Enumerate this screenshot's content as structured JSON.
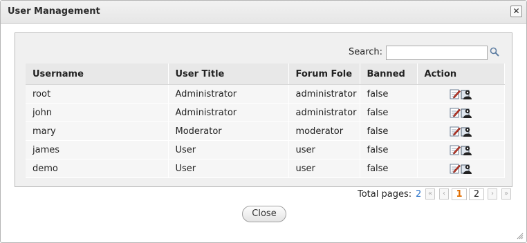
{
  "dialog": {
    "title": "User Management"
  },
  "search": {
    "label": "Search:",
    "value": "",
    "placeholder": ""
  },
  "table": {
    "columns": [
      "Username",
      "User Title",
      "Forum Fole",
      "Banned",
      "Action"
    ],
    "rows": [
      {
        "username": "root",
        "title": "Administrator",
        "role": "administrator",
        "banned": "false"
      },
      {
        "username": "john",
        "title": "Administrator",
        "role": "administrator",
        "banned": "false"
      },
      {
        "username": "mary",
        "title": "Moderator",
        "role": "moderator",
        "banned": "false"
      },
      {
        "username": "james",
        "title": "User",
        "role": "user",
        "banned": "false"
      },
      {
        "username": "demo",
        "title": "User",
        "role": "user",
        "banned": "false"
      }
    ],
    "action_icons": [
      "edit-icon",
      "permissions-icon"
    ]
  },
  "pager": {
    "label": "Total pages:",
    "total": "2",
    "first": "«",
    "prev": "‹",
    "pages": [
      "1",
      "2"
    ],
    "current": "1",
    "next": "›",
    "last": "»"
  },
  "footer": {
    "close_label": "Close"
  },
  "colors": {
    "accent": "#e06d00",
    "link": "#2a73c9"
  }
}
